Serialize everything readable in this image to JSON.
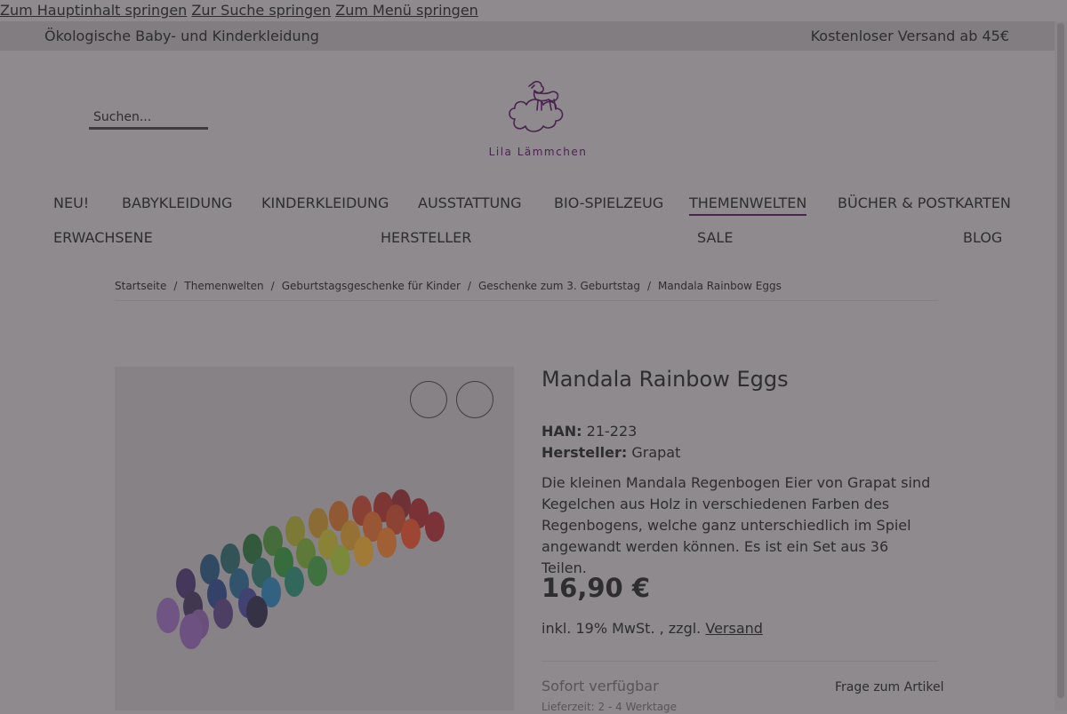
{
  "skip_links": [
    "Zum Hauptinhalt springen",
    "Zur Suche springen",
    "Zum Menü springen"
  ],
  "topbar": {
    "left": "Ökologische Baby- und Kinderkleidung",
    "right": "Kostenloser Versand ab 45€"
  },
  "search": {
    "placeholder": "Suchen..."
  },
  "logo": {
    "text": "Lila Lämmchen"
  },
  "nav": {
    "row1": [
      "NEU!",
      "BABYKLEIDUNG",
      "KINDERKLEIDUNG",
      "AUSSTATTUNG",
      "BIO-SPIELZEUG",
      "THEMENWELTEN",
      "BÜCHER & POSTKARTEN"
    ],
    "row2": [
      "ERWACHSENE",
      "HERSTELLER",
      "SALE",
      "BLOG"
    ],
    "active": "THEMENWELTEN"
  },
  "breadcrumb": [
    "Startseite",
    "Themenwelten",
    "Geburtstagsgeschenke für Kinder",
    "Geschenke zum 3. Geburtstag",
    "Mandala Rainbow Eggs"
  ],
  "product": {
    "title": "Mandala Rainbow Eggs",
    "han_label": "HAN:",
    "han_value": "21-223",
    "manufacturer_label": "Hersteller:",
    "manufacturer_value": "Grapat",
    "description": "Die kleinen Mandala Regenbogen Eier von Grapat sind Kegelchen aus Holz in verschiedenen Farben des Regenbogens, welche ganz unterschiedlich im Spiel angewandt werden können. Es ist ein Set aus 36 Teilen.",
    "price": "16,90 €",
    "tax_text": "inkl. 19% MwSt. , zzgl.",
    "shipping_link": "Versand",
    "availability": "Sofort verfügbar",
    "delivery_time": "Lieferzeit: 2 - 4 Werktage",
    "question_link": "Frage zum Artikel"
  },
  "colors": {
    "overlay_bg": "#8e8a8e",
    "brand_purple": "#4c2350"
  }
}
